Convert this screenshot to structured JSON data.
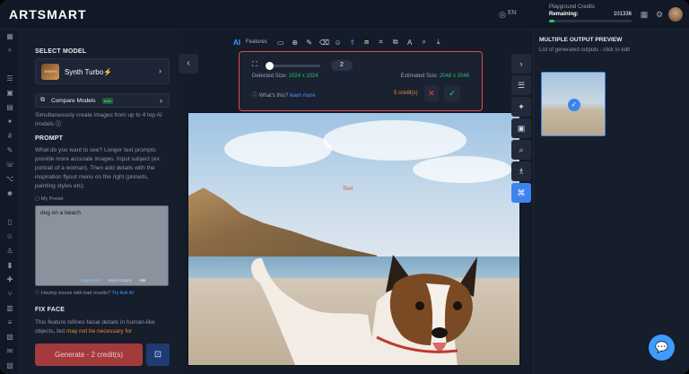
{
  "app": {
    "logo": "ARTSMART",
    "language": "EN"
  },
  "credits": {
    "title": "Playground Credits",
    "remaining_label": "Remaining:",
    "remaining_value": "101336",
    "progress_fraction": 0.06
  },
  "left_panel": {
    "select_model_title": "SELECT MODEL",
    "model_name": "Synth Turbo⚡",
    "model_thumb_text": "SYNTH",
    "compare_label": "Compare Models",
    "compare_badge": "beta",
    "compare_desc": "Simultaneously create images from up to 4 top AI models",
    "prompt_title": "PROMPT",
    "prompt_desc": "What do you want to see? Longer text prompts provide more accurate images. Input subject (ex. portrait of a woman). Then add details with the inspiration flyout menu on the right (presets, painting styles etc).",
    "my_preset": "My Preset",
    "prompt_value": "dog on a beach",
    "tool_suggestions": "Suggestions",
    "tool_more_images": "More Images",
    "tool_ask": "Ask",
    "issue_text": "Having issues with bad results?",
    "issue_link": "Try Ask AI",
    "fix_face_title": "FIX FACE",
    "fix_face_desc_a": "This feature refines facial details in human-like objects, but",
    "fix_face_desc_b": "may not be necessary for",
    "generate_label": "Generate - 2 credit(s)"
  },
  "toolbar": {
    "ai": "AI",
    "features": "Features"
  },
  "upscale": {
    "scale_value": "2",
    "detected_label": "Detected Size:",
    "detected_value": "1024 x 1024",
    "estimated_label": "Estimated Size:",
    "estimated_value": "2048 x 2048",
    "whats_this": "What's this?",
    "learn_more": "learn more",
    "credits": "5 credit(s)"
  },
  "canvas": {
    "mark_text": "Text"
  },
  "right_panel": {
    "title": "MULTIPLE OUTPUT PREVIEW",
    "subtitle": "List of generated outputs - click to edit"
  },
  "colors": {
    "accent": "#3e84f0",
    "danger": "#e14a43",
    "success": "#27c46b",
    "background": "#141b29"
  }
}
